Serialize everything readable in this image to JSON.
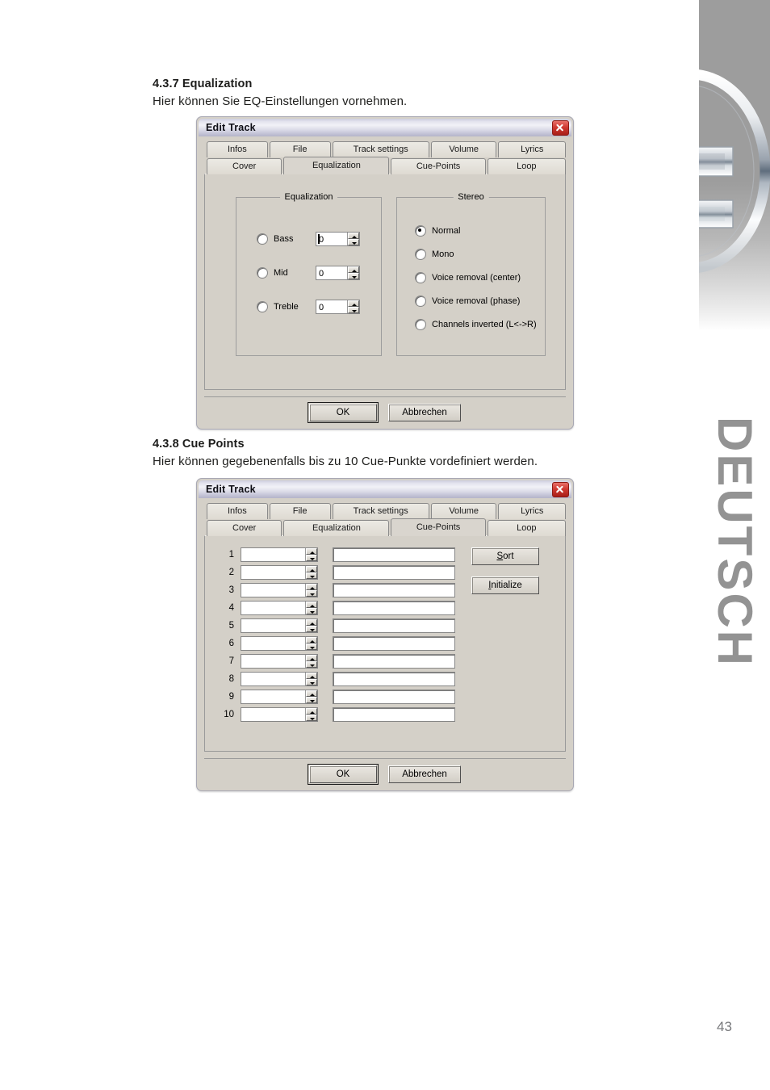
{
  "page": {
    "number": "43",
    "language_tab": "DEUTSCH",
    "logo_name": "chrome-d-logo"
  },
  "sections": [
    {
      "heading": "4.3.7 Equalization",
      "subtext": "Hier können Sie EQ-Einstellungen vornehmen."
    },
    {
      "heading": "4.3.8 Cue Points",
      "subtext": "Hier können gegebenenfalls bis zu 10 Cue-Punkte vordefiniert werden."
    }
  ],
  "dialog_equalization": {
    "title": "Edit Track",
    "close_label": "×",
    "tabs_row1": [
      "Infos",
      "File",
      "Track settings",
      "Volume",
      "Lyrics"
    ],
    "tabs_row2": [
      "Cover",
      "Equalization",
      "Cue-Points",
      "Loop"
    ],
    "active_tab": "Equalization",
    "group_equalization": {
      "title": "Equalization",
      "bands": [
        {
          "label": "Bass",
          "value": "0",
          "selected": false,
          "focused": true
        },
        {
          "label": "Mid",
          "value": "0",
          "selected": false,
          "focused": false
        },
        {
          "label": "Treble",
          "value": "0",
          "selected": false,
          "focused": false
        }
      ]
    },
    "group_stereo": {
      "title": "Stereo",
      "options": [
        {
          "label": "Normal",
          "selected": true
        },
        {
          "label": "Mono",
          "selected": false
        },
        {
          "label": "Voice removal (center)",
          "selected": false
        },
        {
          "label": "Voice removal (phase)",
          "selected": false
        },
        {
          "label": "Channels inverted (L<->R)",
          "selected": false
        }
      ]
    },
    "buttons": {
      "ok": "OK",
      "cancel": "Abbrechen"
    }
  },
  "dialog_cuepoints": {
    "title": "Edit Track",
    "close_label": "×",
    "tabs_row1": [
      "Infos",
      "File",
      "Track settings",
      "Volume",
      "Lyrics"
    ],
    "tabs_row2": [
      "Cover",
      "Equalization",
      "Cue-Points",
      "Loop"
    ],
    "active_tab": "Cue-Points",
    "rows": [
      {
        "num": "1",
        "time": "",
        "name": ""
      },
      {
        "num": "2",
        "time": "",
        "name": ""
      },
      {
        "num": "3",
        "time": "",
        "name": ""
      },
      {
        "num": "4",
        "time": "",
        "name": ""
      },
      {
        "num": "5",
        "time": "",
        "name": ""
      },
      {
        "num": "6",
        "time": "",
        "name": ""
      },
      {
        "num": "7",
        "time": "",
        "name": ""
      },
      {
        "num": "8",
        "time": "",
        "name": ""
      },
      {
        "num": "9",
        "time": "",
        "name": ""
      },
      {
        "num": "10",
        "time": "",
        "name": ""
      }
    ],
    "side_buttons": [
      {
        "label": "Sort",
        "accel": "S"
      },
      {
        "label": "Initialize",
        "accel": "I"
      }
    ],
    "buttons": {
      "ok": "OK",
      "cancel": "Abbrechen"
    }
  },
  "colors": {
    "dialog_face": "#d4d0c8",
    "titlebar": "#dcdce8",
    "close_red": "#c8302a",
    "rail_gray": "#9d9d9d",
    "deutsch_gray": "#939393"
  }
}
